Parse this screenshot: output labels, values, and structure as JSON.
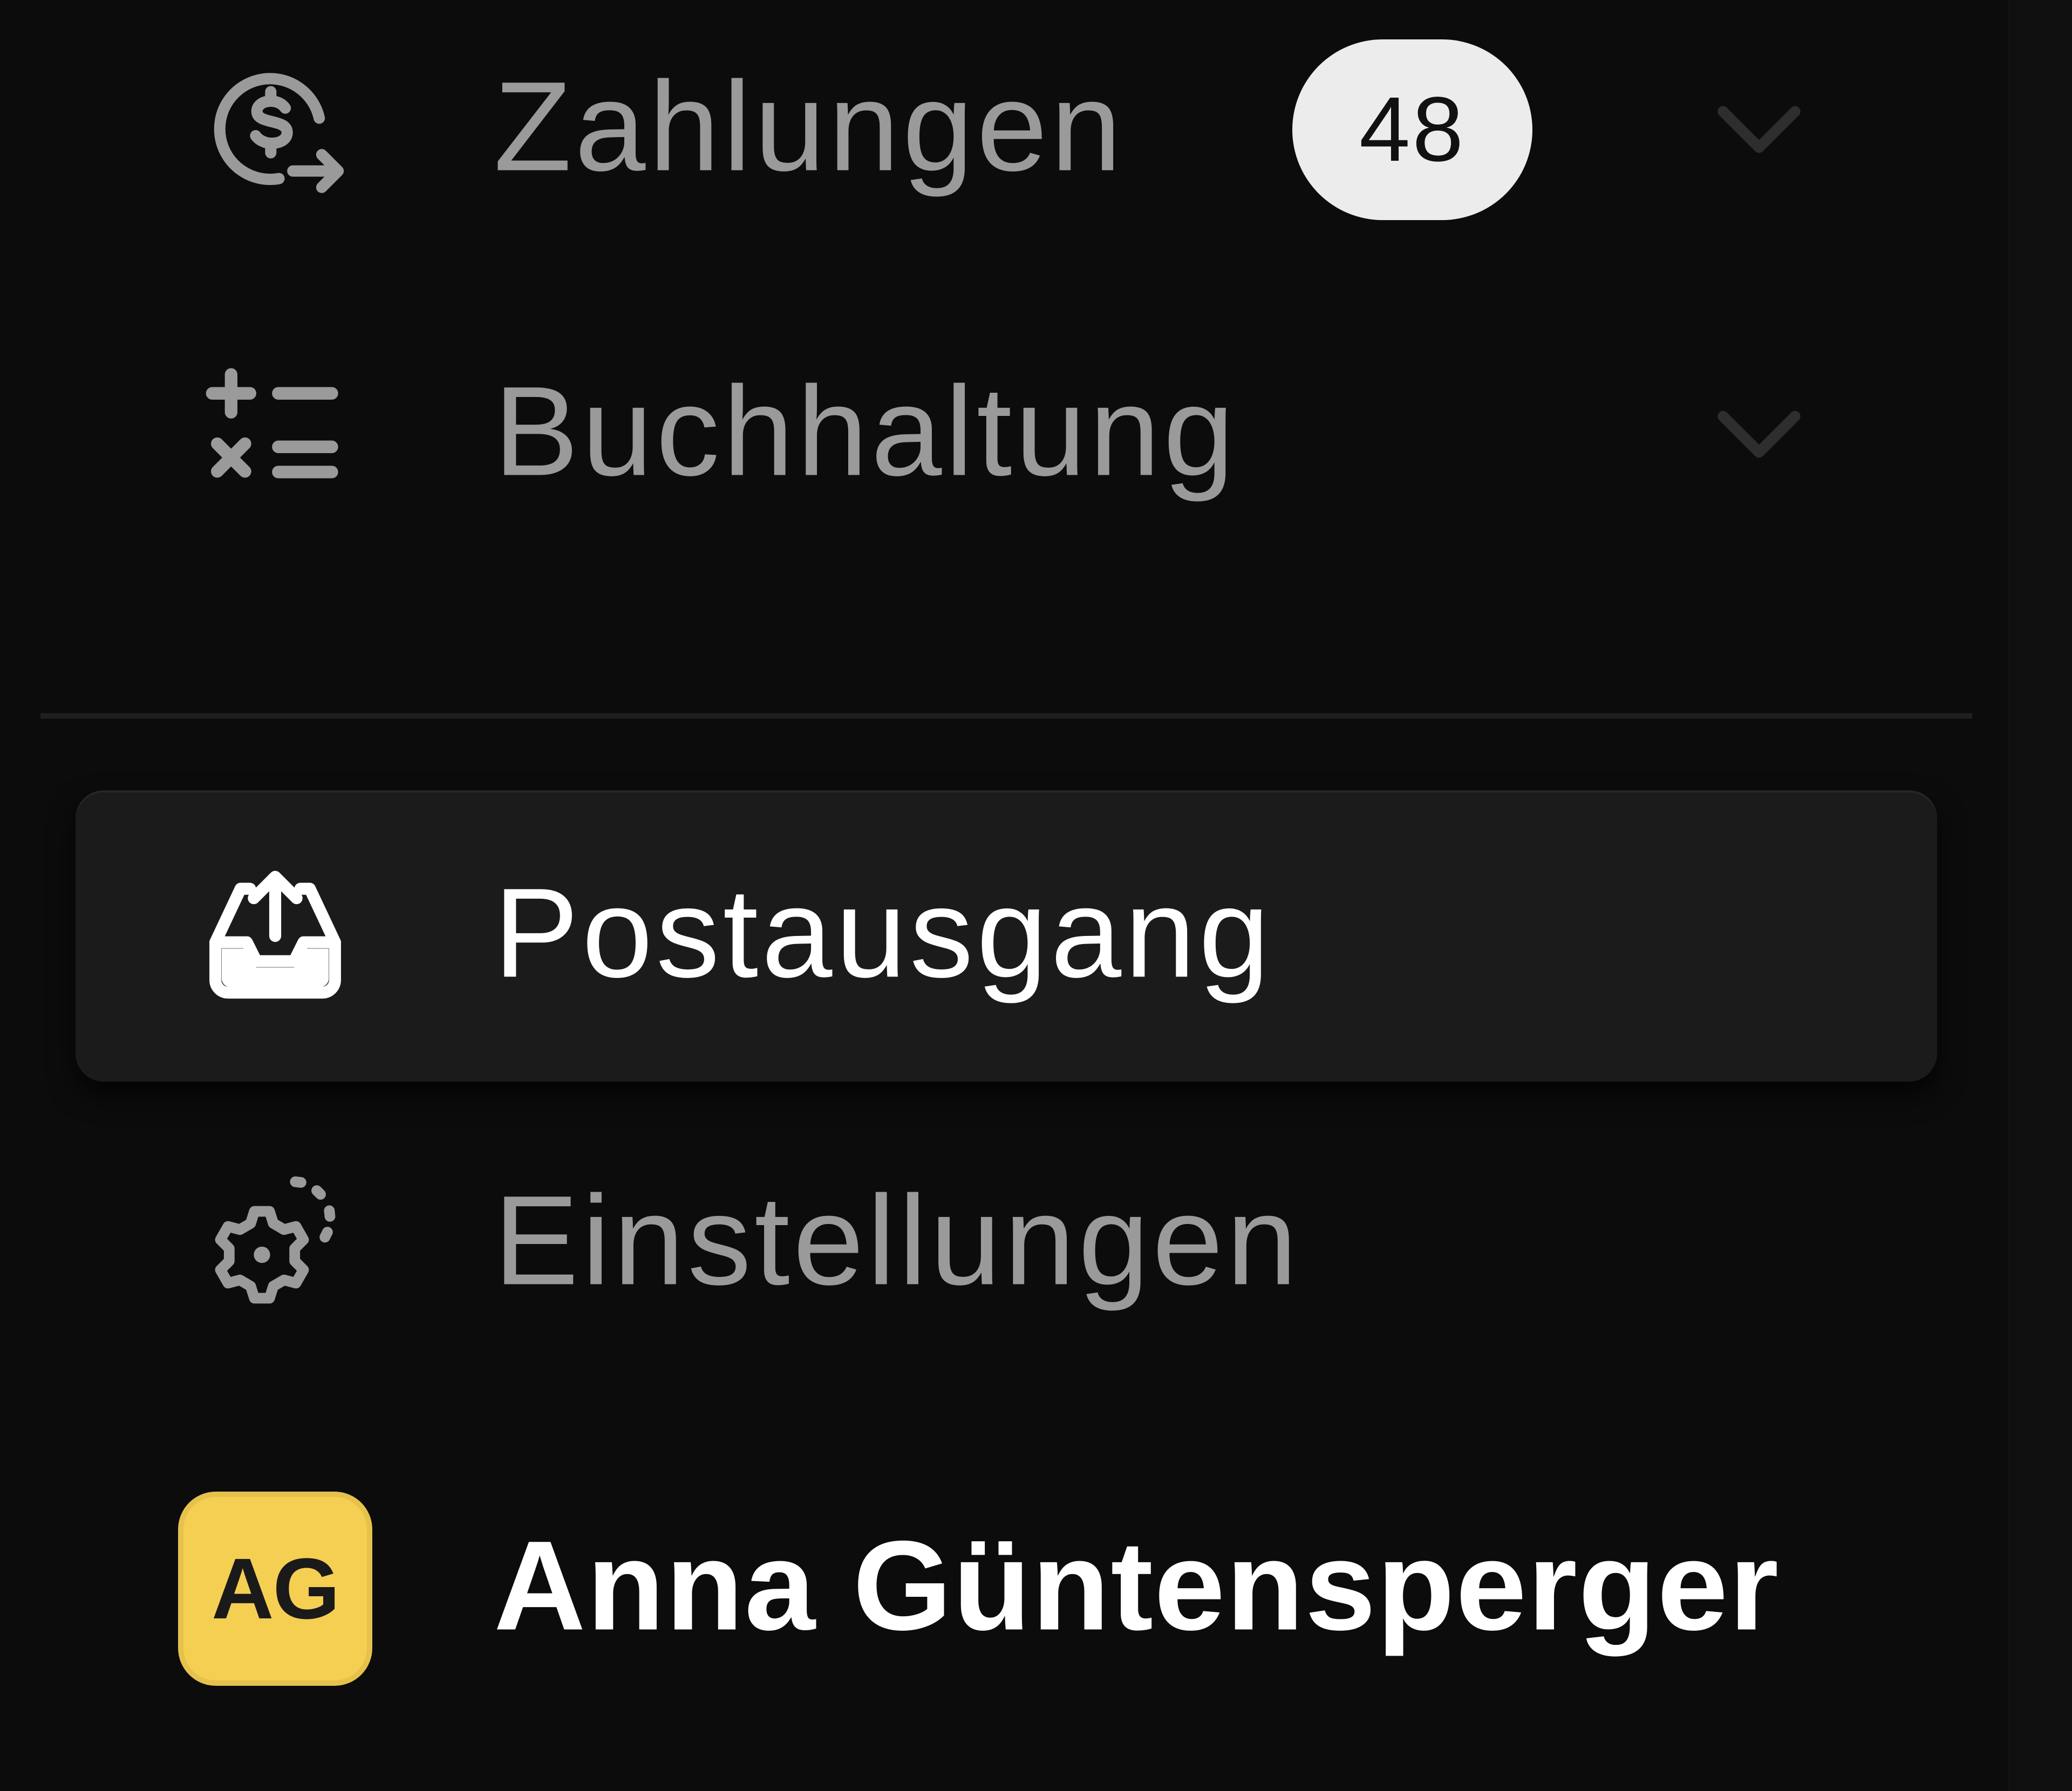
{
  "sidebar": {
    "items": [
      {
        "label": "Zahlungen",
        "icon": "payment-transfer-icon",
        "badge": "48",
        "expandable": true,
        "active": false
      },
      {
        "label": "Buchhaltung",
        "icon": "calculator-icon",
        "expandable": true,
        "active": false
      },
      {
        "label": "Postausgang",
        "icon": "outbox-upload-icon",
        "active": true
      },
      {
        "label": "Einstellungen",
        "icon": "gear-icon",
        "active": false
      }
    ],
    "user": {
      "initials": "AG",
      "name": "Anna Güntensperger",
      "avatar_color": "#f5cf52"
    }
  },
  "colors": {
    "background": "#0c0c0c",
    "active_item_background": "#1b1b1b",
    "inactive_text": "#9a9a9a",
    "active_text": "#ffffff",
    "badge_background": "#ececec"
  }
}
